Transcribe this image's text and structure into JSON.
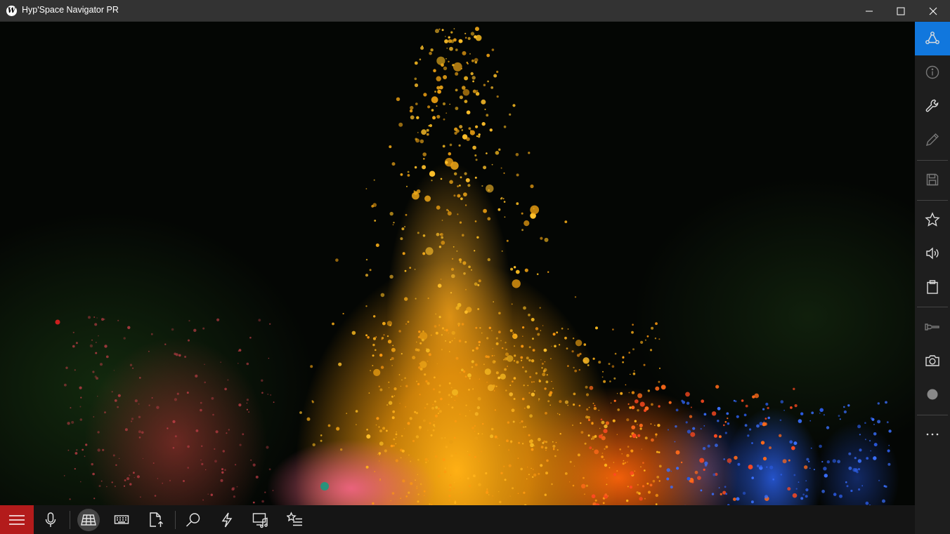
{
  "window": {
    "title": "Hyp'Space Navigator PR",
    "app_icon_letter": "W",
    "controls": [
      "minimize-icon",
      "maximize-icon",
      "close-icon"
    ]
  },
  "background": {
    "colors": {
      "accent": "#1177dd",
      "menu_button": "#b31b1b",
      "titlebar": "#333333",
      "toolbar": "#151515"
    }
  },
  "right_toolbar": {
    "items": [
      {
        "icon": "share-triangle-icon",
        "active": true
      },
      {
        "icon": "info-icon"
      },
      {
        "icon": "wrench-icon"
      },
      {
        "icon": "pencil-icon",
        "disabled": true
      },
      {
        "icon": "save-icon",
        "disabled": true
      },
      {
        "icon": "star-icon"
      },
      {
        "icon": "speaker-icon"
      },
      {
        "icon": "clipboard-icon"
      },
      {
        "icon": "flashlight-icon",
        "disabled": true
      },
      {
        "icon": "camera-icon"
      },
      {
        "icon": "record-icon",
        "disabled": true
      },
      {
        "icon": "more-icon"
      }
    ]
  },
  "bottom_toolbar": {
    "items": [
      {
        "icon": "hamburger-menu-icon"
      },
      {
        "icon": "microphone-icon"
      },
      {
        "icon": "grid-globe-icon",
        "active": true
      },
      {
        "icon": "keyboard-icon"
      },
      {
        "icon": "document-upload-icon"
      },
      {
        "icon": "search-icon"
      },
      {
        "icon": "lightning-icon"
      },
      {
        "icon": "media-icon"
      },
      {
        "icon": "favorites-list-icon"
      }
    ]
  }
}
